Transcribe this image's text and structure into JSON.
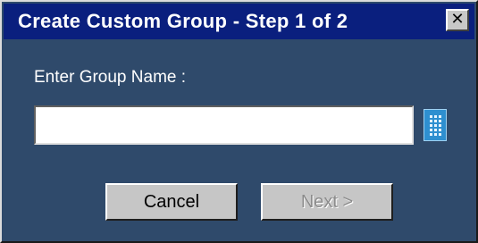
{
  "dialog": {
    "title": "Create Custom Group - Step 1 of 2",
    "close_symbol": "✕"
  },
  "form": {
    "prompt_label": "Enter Group Name :",
    "group_name_value": "",
    "keypad_icon": "keypad-icon"
  },
  "buttons": {
    "cancel_label": "Cancel",
    "next_label": "Next >",
    "next_enabled": false
  },
  "colors": {
    "titlebar": "#0a1f7e",
    "dialog_bg": "#2f4a6b",
    "keypad": "#2e8fd0"
  }
}
